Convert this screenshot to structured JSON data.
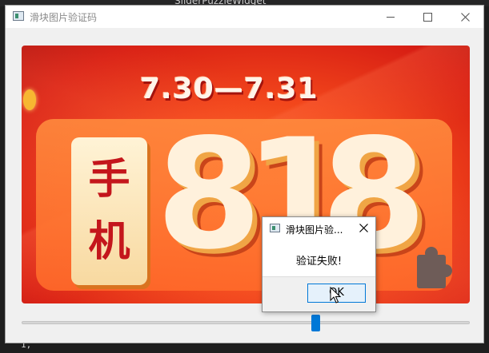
{
  "background_ide": {
    "tab_title": "SliderPuzzleWidget",
    "code_fragment": "1,"
  },
  "window": {
    "title": "滑块图片验证码",
    "icons": {
      "app": "app-window-icon",
      "minimize": "minimize-icon",
      "maximize": "maximize-icon",
      "close": "close-icon"
    }
  },
  "puzzle": {
    "banner_date": "7.30—7.31",
    "banner_chars": [
      "手",
      "机"
    ],
    "banner_digits": [
      "8",
      "1",
      "8"
    ],
    "missing_piece_icon": "puzzle-piece-slot"
  },
  "slider": {
    "progress": 0.66,
    "accent": "#0078d7"
  },
  "message_box": {
    "title": "滑块图片验...",
    "message": "验证失败!",
    "ok_label": "OK",
    "close_icon": "close-icon"
  }
}
